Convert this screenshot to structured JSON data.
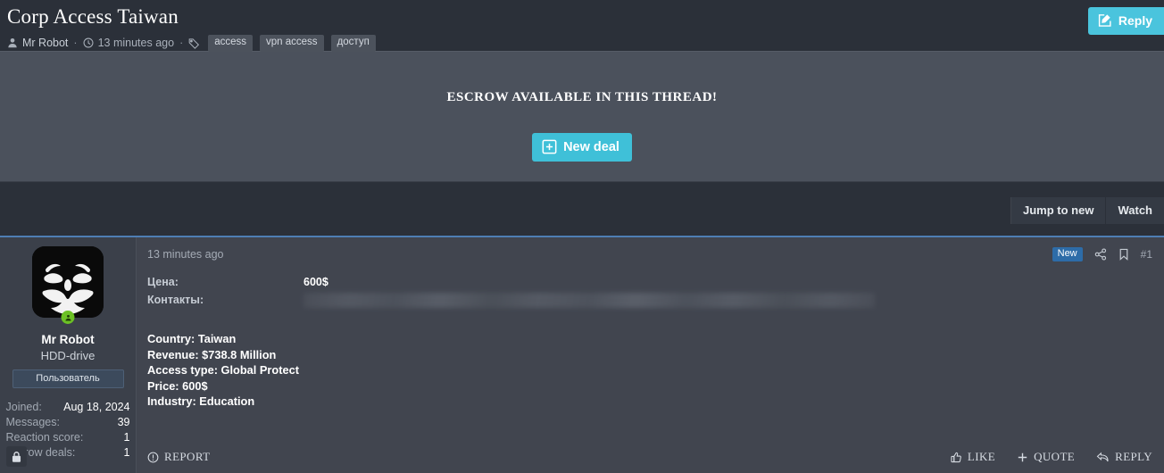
{
  "thread": {
    "title": "Corp Access Taiwan",
    "author": "Mr Robot",
    "posted": "13 minutes ago",
    "separator": "·",
    "tags": [
      "access",
      "vpn access",
      "доступ"
    ],
    "reply_label": "Reply"
  },
  "escrow": {
    "headline": "ESCROW AVAILABLE IN THIS THREAD!",
    "new_deal_label": "New deal"
  },
  "subnav": {
    "jump_to_new": "Jump to new",
    "watch": "Watch"
  },
  "author_card": {
    "username": "Mr Robot",
    "user_title": "HDD-drive",
    "user_banner": "Пользователь",
    "stats": [
      {
        "key": "Joined:",
        "value": "Aug 18, 2024"
      },
      {
        "key": "Messages:",
        "value": "39"
      },
      {
        "key": "Reaction score:",
        "value": "1"
      },
      {
        "key": "Escrow deals:",
        "value": "1"
      }
    ]
  },
  "post": {
    "time": "13 minutes ago",
    "new_badge": "New",
    "post_number": "#1",
    "fields": [
      {
        "key": "Цена:",
        "value": "600$"
      },
      {
        "key": "Контакты:",
        "value": ""
      }
    ],
    "body_lines": [
      "Country: Taiwan",
      "Revenue: $738.8 Million",
      "Access type: Global Protect",
      "Price: 600$",
      "Industry: Education"
    ],
    "report_label": "REPORT",
    "like_label": "LIKE",
    "quote_label": "QUOTE",
    "reply_label": "REPLY"
  },
  "colors": {
    "accent_cyan": "#3fc0d8",
    "badge_blue": "#2d6ca8",
    "top_border_blue": "#4e7eb4",
    "online_green": "#6cc125"
  }
}
